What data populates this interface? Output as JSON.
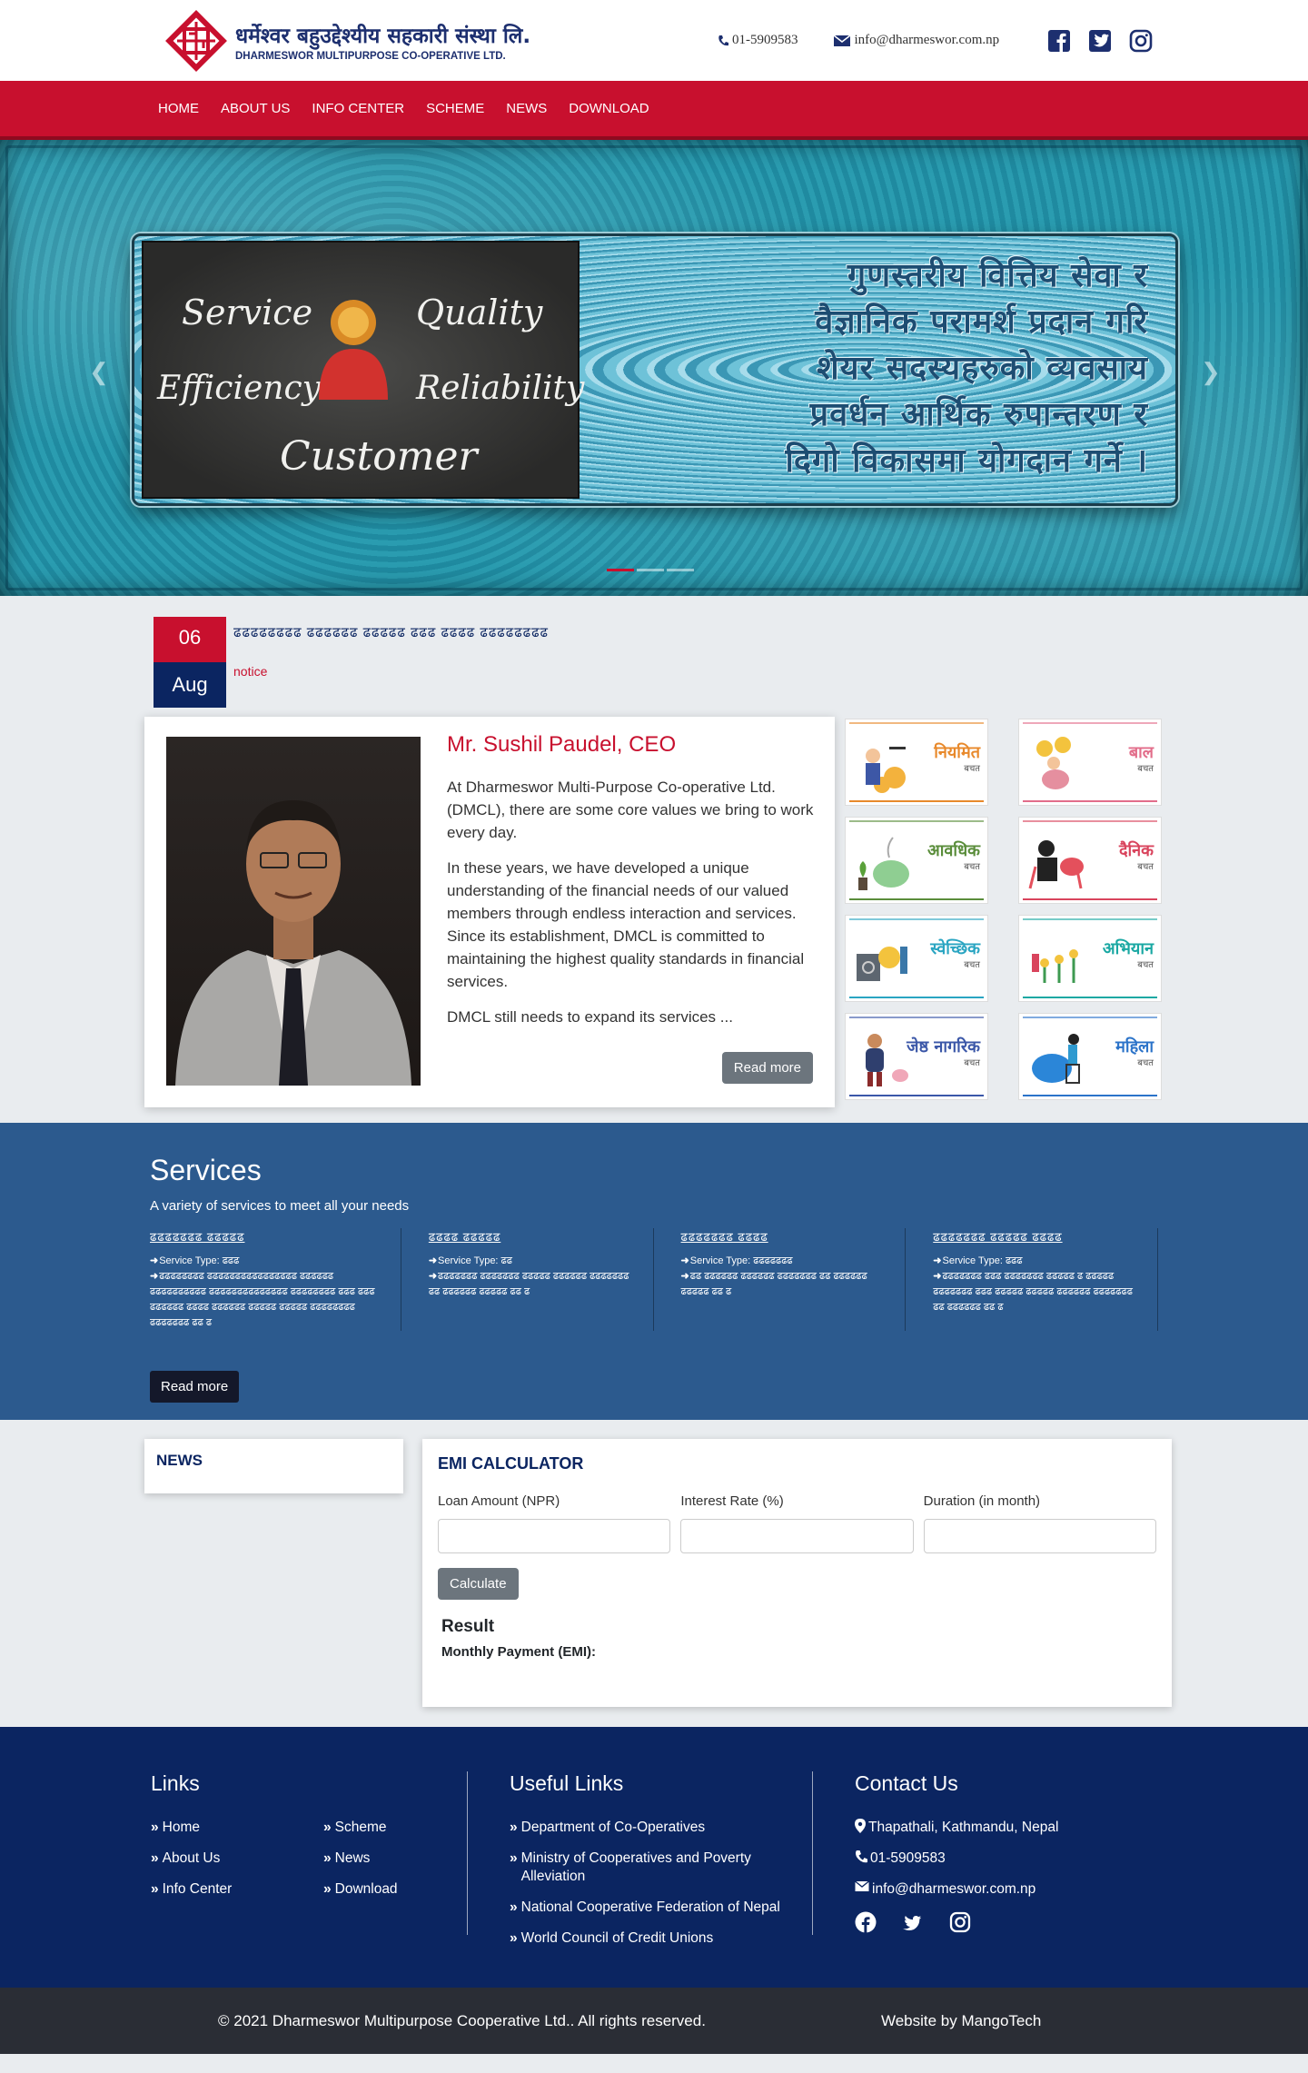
{
  "header": {
    "logo_np": "धर्मेश्वर बहुउद्देश्यीय सहकारी संस्था लि.",
    "logo_en": "DHARMESWOR MULTIPURPOSE CO-OPERATIVE LTD.",
    "phone": "01-5909583",
    "email": "info@dharmeswor.com.np",
    "social_icons": [
      "facebook-icon",
      "twitter-icon",
      "instagram-icon"
    ]
  },
  "nav": [
    "HOME",
    "ABOUT US",
    "INFO CENTER",
    "SCHEME",
    "NEWS",
    "DOWNLOAD"
  ],
  "hero": {
    "board_words": [
      "Service",
      "Quality",
      "Efficiency",
      "Reliability",
      "Customer"
    ],
    "tagline_lines": [
      "गुणस्तरीय वित्तिय सेवा र",
      "वैज्ञानिक परामर्श प्रदान गरि",
      "शेयर सदस्यहरुको व्यवसाय",
      "प्रवर्धन आर्थिक रुपान्तरण र",
      "दिगो विकासमा योगदान गर्ने ।"
    ],
    "slide_count": 3,
    "active_slide": 1
  },
  "notice": {
    "day": "06",
    "month": "Aug",
    "title": "ढढढढढढढढ ढढढढढढ ढढढढढ ढढढ ढढढढ ढढढढढढढढ",
    "tag": "notice"
  },
  "ceo": {
    "name": "Mr. Sushil Paudel, CEO",
    "paragraphs": [
      "At Dharmeswor Multi-Purpose Co-operative Ltd. (DMCL), there are some core values we bring to work every day.",
      "In these years, we have developed a unique understanding of the financial needs of our valued members through endless interaction and services. Since its establishment, DMCL is committed to maintaining the highest quality standards in financial services.",
      "DMCL still needs to expand its services ..."
    ],
    "read_more": "Read more"
  },
  "schemes": [
    {
      "title": "नियमित",
      "sub": "बचत",
      "color": "#e8892b"
    },
    {
      "title": "बाल",
      "sub": "बचत",
      "color": "#e26d8a"
    },
    {
      "title": "आवधिक",
      "sub": "बचत",
      "color": "#5a8d3b"
    },
    {
      "title": "दैनिक",
      "sub": "बचत",
      "color": "#d9445d"
    },
    {
      "title": "स्वेच्छिक",
      "sub": "बचत",
      "color": "#2aa5c2"
    },
    {
      "title": "अभियान",
      "sub": "बचत",
      "color": "#1aa8a3"
    },
    {
      "title": "जेष्ठ नागरिक",
      "sub": "बचत",
      "color": "#3b57a8"
    },
    {
      "title": "महिला",
      "sub": "बचत",
      "color": "#2b73c9"
    }
  ],
  "services": {
    "title": "Services",
    "subtitle": "A variety of services to meet all your needs",
    "items": [
      {
        "name": "ढढढढढढढ ढढढढढ",
        "type": "Service Type: ढढढ",
        "desc": "ढढढढढढढढ ढढढढढढढढढढढढढढढढ ढढढढढढ ढढढढढढढढढढ ढढढढढढढढढढढढढढ ढढढढढढढढ ढढढ ढढढ ढढढढढढ ढढढढ ढढढढढढ ढढढढढ ढढढढढ ढढढढढढढढ ढढढढढढढ ढढ ढ"
      },
      {
        "name": "ढढढढ ढढढढढ",
        "type": "Service Type: ढढ",
        "desc": "ढढढढढढढ ढढढढढढढ ढढढढढ ढढढढढढ ढढढढढढढ ढढ ढढढढढढ ढढढढढ ढढ ढ"
      },
      {
        "name": "ढढढढढढढ ढढढढ",
        "type": "Service Type: ढढढढढढढ",
        "desc": "ढढ ढढढढढढ ढढढढढढ ढढढढढढढ ढढ ढढढढढढ ढढढढढ ढढ ढ"
      },
      {
        "name": "ढढढढढढढ ढढढढढ ढढढढ",
        "type": "Service Type: ढढढ",
        "desc": "ढढढढढढढ ढढढ ढढढढढढढ ढढढढढ ढ ढढढढढ ढढढढढढढ ढढढ ढढढढढ ढढढढढ ढढढढढढ ढढढढढढढ ढढ ढढढढढढ ढढ ढ"
      }
    ],
    "read_more": "Read more"
  },
  "news": {
    "title": "NEWS"
  },
  "emi": {
    "title": "EMI CALCULATOR",
    "fields": [
      {
        "label": "Loan Amount (NPR)",
        "value": ""
      },
      {
        "label": "Interest Rate (%)",
        "value": ""
      },
      {
        "label": "Duration (in month)",
        "value": ""
      }
    ],
    "button": "Calculate",
    "result_title": "Result",
    "result_label": "Monthly Payment (EMI):"
  },
  "footer": {
    "links_title": "Links",
    "links": [
      "Home",
      "Scheme",
      "About Us",
      "News",
      "Info Center",
      "Download"
    ],
    "useful_title": "Useful Links",
    "useful": [
      "Department of Co-Operatives",
      "Ministry of Cooperatives and Poverty Alleviation",
      "National Cooperative Federation of Nepal",
      "World Council of Credit Unions"
    ],
    "contact_title": "Contact Us",
    "address": "Thapathali, Kathmandu, Nepal",
    "phone": "01-5909583",
    "email": "info@dharmeswor.com.np",
    "copyright": "© 2021 Dharmeswor Multipurpose Cooperative Ltd.. All rights reserved.",
    "credit": "Website by MangoTech"
  },
  "colors": {
    "brand_red": "#c8102e",
    "brand_navy": "#0b2561",
    "services_blue": "#2c5a8e"
  }
}
